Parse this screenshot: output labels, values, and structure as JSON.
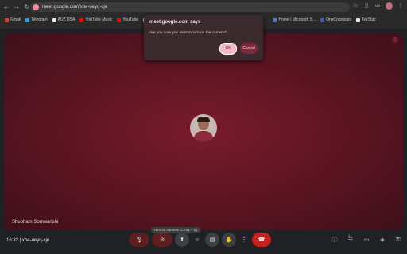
{
  "browser": {
    "url": "meet.google.com/xbe-ueyq-cje",
    "bookmarks": [
      {
        "label": "Gmail",
        "color": "#d14836"
      },
      {
        "label": "Telegram",
        "color": "#2aa3dd"
      },
      {
        "label": "AUZ DSA",
        "color": "#e8e8e8"
      },
      {
        "label": "YouTube Music",
        "color": "#ff0000"
      },
      {
        "label": "YouTube",
        "color": "#ff0000"
      },
      {
        "label": "Ch",
        "color": "#bdbdbd"
      },
      {
        "label": "Home | Microsoft S...",
        "color": "#4a7ecf"
      },
      {
        "label": "OneCognizant",
        "color": "#3b5bdb"
      },
      {
        "label": "TekStac",
        "color": "#e5e5e5"
      }
    ]
  },
  "dialog": {
    "title": "meet.google.com says",
    "message": "Are you sure you want to turn on the camera?",
    "ok_label": "OK",
    "cancel_label": "Cancel"
  },
  "meeting": {
    "participant_name": "Shubham Somwanshi",
    "time": "16:32",
    "code": "xbe-ueyq-cje",
    "tooltip": "Turn on camera (CTRL + E)",
    "participant_count": "1"
  },
  "colors": {
    "accent": "#f6b8c5",
    "end_call": "#c5221f",
    "tile_bg": "#5a1422"
  }
}
